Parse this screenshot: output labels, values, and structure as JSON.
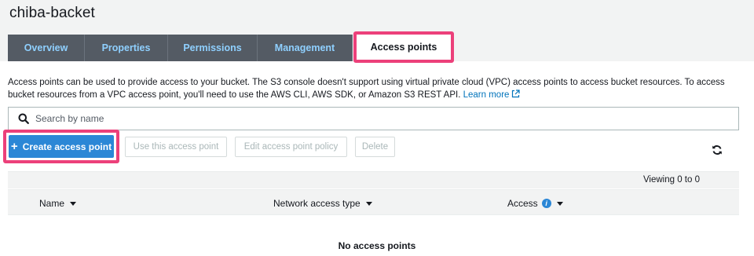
{
  "page": {
    "title": "chiba-backet"
  },
  "tabs": [
    {
      "label": "Overview"
    },
    {
      "label": "Properties"
    },
    {
      "label": "Permissions"
    },
    {
      "label": "Management"
    },
    {
      "label": "Access points",
      "active": true
    }
  ],
  "description": {
    "text": "Access points can be used to provide access to your bucket. The S3 console doesn't support using virtual private cloud (VPC) access points to access bucket resources. To access bucket resources from a VPC access point, you'll need to use the AWS CLI, AWS SDK, or Amazon S3 REST API.",
    "link_label": "Learn more"
  },
  "search": {
    "placeholder": "Search by name",
    "value": ""
  },
  "toolbar": {
    "create_label": "Create access point",
    "use_label": "Use this access point",
    "edit_label": "Edit access point policy",
    "delete_label": "Delete"
  },
  "table": {
    "viewing": "Viewing 0 to 0",
    "columns": [
      {
        "label": "Name"
      },
      {
        "label": "Network access type"
      },
      {
        "label": "Access"
      }
    ],
    "empty_message": "No access points"
  },
  "colors": {
    "highlight": "#ec407a",
    "tab_bg": "#545b64",
    "tab_text": "#8fd0ff",
    "primary": "#2b87d6",
    "link": "#0073bb"
  },
  "icons": {
    "search": "search-icon",
    "external": "external-link-icon",
    "refresh": "refresh-icon",
    "info": "info-icon"
  }
}
